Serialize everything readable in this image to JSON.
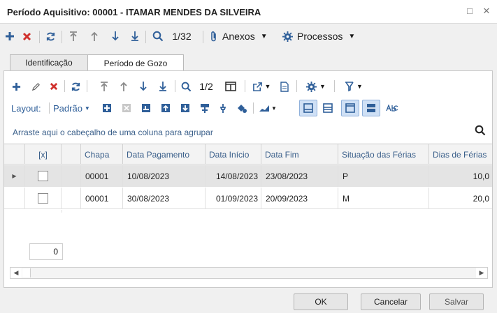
{
  "window": {
    "title": "Período Aquisitivo: 00001 - ITAMAR MENDES DA SILVEIRA",
    "minimize_glyph": "□",
    "close_glyph": "✕"
  },
  "main_toolbar": {
    "record_position": "1/32",
    "attachments_label": "Anexos",
    "processes_label": "Processos"
  },
  "tabs": [
    {
      "label": "Identificação",
      "active": false
    },
    {
      "label": "Período de Gozo",
      "active": true
    }
  ],
  "grid_toolbar": {
    "record_position": "1/2",
    "layout_label": "Layout:",
    "layout_value": "Padrão"
  },
  "group_hint": "Arraste aqui o cabeçalho de uma coluna para agrupar",
  "grid": {
    "columns": [
      "",
      "[x]",
      "",
      "Chapa",
      "Data Pagamento",
      "Data Início",
      "Data Fim",
      "Situação das Férias",
      "Dias de Férias"
    ],
    "rows": [
      {
        "chapa": "00001",
        "data_pagamento": "10/08/2023",
        "data_inicio": "14/08/2023",
        "data_fim": "23/08/2023",
        "situacao": "P",
        "dias": "10,0"
      },
      {
        "chapa": "00001",
        "data_pagamento": "30/08/2023",
        "data_inicio": "01/09/2023",
        "data_fim": "20/09/2023",
        "situacao": "M",
        "dias": "20,0"
      }
    ],
    "count": "0"
  },
  "dialog_buttons": {
    "ok": "OK",
    "cancel": "Cancelar",
    "save": "Salvar"
  },
  "colors": {
    "accent_blue": "#2f5f99",
    "delete_red": "#d0312d",
    "toolbar_bg": "#f0f0f0"
  }
}
